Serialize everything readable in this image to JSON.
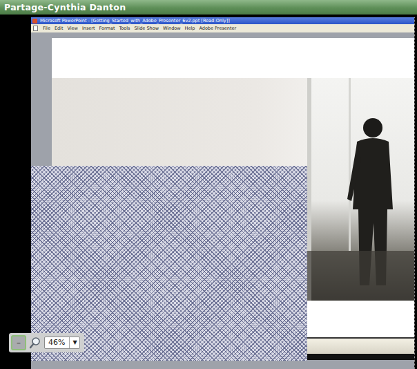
{
  "window": {
    "title": "Partage-Cynthia Danton"
  },
  "app": {
    "title": "Microsoft PowerPoint - [Getting_Started_with_Adobe_Presenter_6v2.ppt [Read-Only]]",
    "menu": [
      "File",
      "Edit",
      "View",
      "Insert",
      "Format",
      "Tools",
      "Slide Show",
      "Window",
      "Help",
      "Adobe Presenter"
    ]
  },
  "zoom": {
    "button": "–",
    "value": "46%",
    "arrow": "▼"
  }
}
